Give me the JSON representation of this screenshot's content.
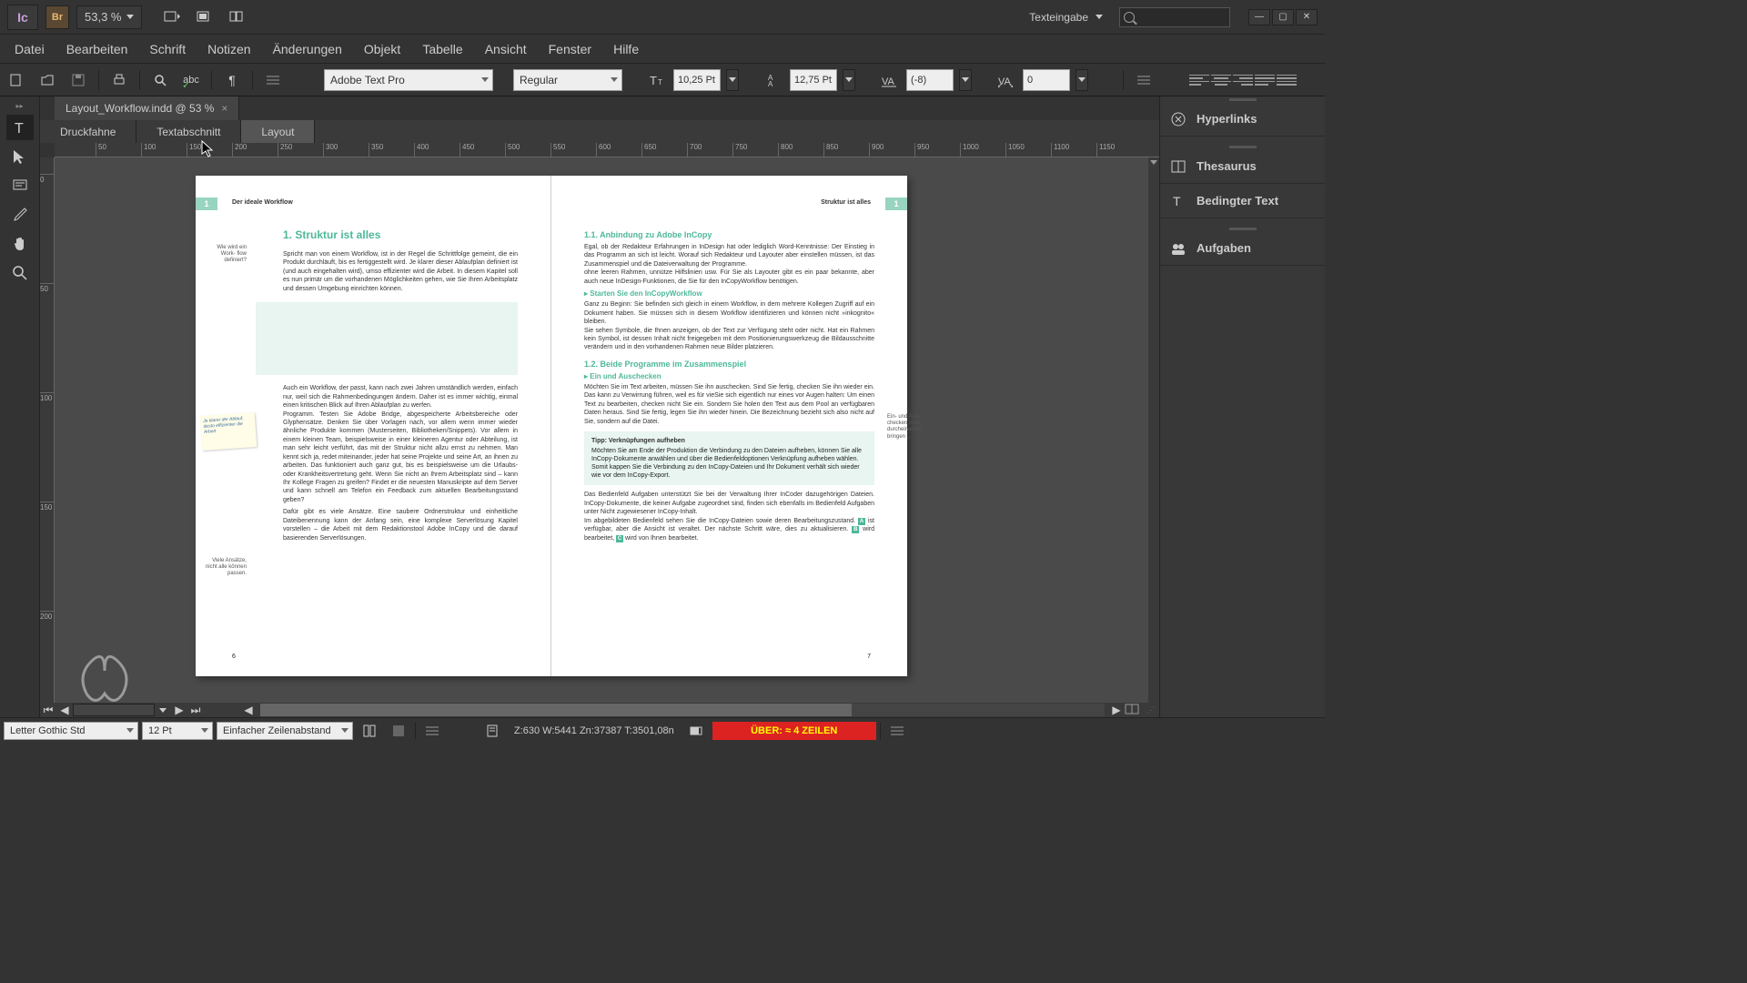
{
  "titlebar": {
    "ic_label": "Ic",
    "br_label": "Br",
    "zoom": "53,3 %",
    "workspace": "Texteingabe"
  },
  "menu": [
    "Datei",
    "Bearbeiten",
    "Schrift",
    "Notizen",
    "Änderungen",
    "Objekt",
    "Tabelle",
    "Ansicht",
    "Fenster",
    "Hilfe"
  ],
  "controlbar": {
    "font": "Adobe Text Pro",
    "font_style": "Regular",
    "font_size": "10,25 Pt",
    "leading": "12,75 Pt",
    "kerning": "(-8)",
    "tracking": "0"
  },
  "doc_tab": {
    "title": "Layout_Workflow.indd @ 53 %",
    "close": "×"
  },
  "view_tabs": [
    "Druckfahne",
    "Textabschnitt",
    "Layout"
  ],
  "ruler_h": [
    "50",
    "100",
    "150",
    "200",
    "250",
    "300",
    "350",
    "400",
    "450",
    "500",
    "550",
    "600",
    "650",
    "700",
    "750",
    "800",
    "850",
    "900",
    "950",
    "1000",
    "1050",
    "1100",
    "1150"
  ],
  "ruler_v": [
    "0",
    "50",
    "100",
    "150",
    "200"
  ],
  "panels": [
    "Hyperlinks",
    "Thesaurus",
    "Bedingter Text",
    "Aufgaben"
  ],
  "statusbar": {
    "font": "Letter Gothic Std",
    "size": "12 Pt",
    "leading_mode": "Einfacher Zeilenabstand",
    "stats": "Z:630    W:5441    Zn:37387   T:3501,08n",
    "overset": "ÜBER:   ≈ 4 ZEILEN"
  },
  "doc": {
    "left": {
      "badge": "1",
      "running": "Der ideale Workflow",
      "h1": "1.   Struktur ist alles",
      "side1": "Wie wird ein Work-\nflow definiert?",
      "p1": "Spricht man von einem Workflow, ist in der Regel die Schrittfolge gemeint, die ein Produkt durchläuft, bis es fertiggestellt wird. Je klarer dieser Ablaufplan definiert ist (und auch eingehalten wird), umso effizienter wird die Arbeit. In diesem Kapitel soll es nun primär um die vorhandenen Möglichkeiten gehen, wie Sie Ihren Arbeitsplatz und dessen Umgebung einrichten können.",
      "sticky": "Je klarer der Ablauf, desto effizienter die Arbeit",
      "p2": "Auch ein Workflow, der passt, kann nach zwei Jahren umständlich werden, einfach nur, weil sich die Rahmenbedingungen ändern. Daher ist es immer wichtig, einmal einen kritischen Blick auf Ihren Ablaufplan zu werfen.",
      "p2b": "Programm. Testen Sie Adobe Bridge, abgespeicherte Arbeitsbereiche oder Glyphensätze. Denken Sie über Vorlagen nach, vor allem wenn immer wieder ähnliche Produkte kommen (Musterseiten, Bibliotheken/Snippets). Vor allem in einem kleinen Team, beispielsweise in einer kleineren Agentur oder Abteilung, ist man sehr leicht verführt, das mit der Struktur nicht allzu ernst zu nehmen. Man kennt sich ja, redet miteinander, jeder hat seine Projekte und seine Art, an ihnen zu arbeiten. Das funktioniert auch ganz gut, bis es beispielsweise um die Urlaubs- oder Krankheitsvertretung geht. Wenn Sie nicht an Ihrem Arbeitsplatz sind – kann Ihr Kollege Fragen zu greifen? Findet er die neuesten Manuskripte auf dem Server und kann schnell am Telefon ein Feedback zum aktuellen Bearbeitungsstand geben?",
      "side3": "Viele Ansätze,\nnicht alle können\npassen.",
      "p3": "Dafür gibt es viele Ansätze. Eine saubere Ordnerstruktur und einheitliche Dateibenennung kann der Anfang sein, eine komplexe Serverlösung Kapitel vorstellen – die Arbeit mit dem Redaktionstool Adobe InCopy und die darauf basierenden Serverlösungen.",
      "pnum": "6"
    },
    "right": {
      "badge": "1",
      "running": "Struktur ist alles",
      "h2a": "1.1.   Anbindung zu Adobe InCopy",
      "p1": "Egal, ob der Redakteur Erfahrungen in InDesign hat oder lediglich Word-Kenntnisse: Der Einstieg in das Programm an sich ist leicht. Worauf sich Redakteur und Layouter aber einstellen müssen, ist das Zusammenspiel und die Dateiverwaltung der Programme.",
      "p1b": "ohne leeren Rahmen, unnütze Hilfslinien usw. Für Sie als Layouter gibt es ein paar bekannte, aber auch neue InDesign-Funktionen, die Sie für den InCopyWorkflow benötigen.",
      "h3a": "▸  Starten Sie den InCopyWorkflow",
      "p2": "Ganz zu Beginn: Sie befinden sich gleich in einem Workflow, in dem mehrere Kollegen Zugriff auf ein Dokument haben. Sie müssen sich in diesem Workflow identifizieren und können nicht »inkognito« bleiben.",
      "p2b": "Sie sehen Symbole, die Ihnen anzeigen, ob der Text zur Verfügung steht oder nicht. Hat ein Rahmen kein Symbol, ist dessen Inhalt nicht freigegeben mit dem Positionierungswerkzeug die Bildausschnitte verändern und in den vorhandenen Rahmen neue Bilder platzieren.",
      "h2b": "1.2.   Beide Programme im Zusammenspiel",
      "h3b": "▸  Ein und Auschecken",
      "side_r": "Ein- und Aus-\nchecken nicht\ndurcheinander\nbringen …",
      "p3": "Möchten Sie im Text arbeiten, müssen Sie ihn auschecken. Sind Sie fertig, checken Sie ihn wieder ein. Das kann zu Verwirrung führen, weil es für vieSie sich eigentlich nur eines vor Augen halten: Um einen Text zu bearbeiten, checken nicht Sie ein. Sondern Sie holen den Text aus dem Pool an verfügbaren Daten heraus. Sind Sie fertig, legen Sie ihn wieder hinein. Die Bezeichnung bezieht sich also nicht auf Sie, sondern auf die Datei.",
      "tip_title": "Tipp: Verknüpfungen aufheben",
      "tip_body": "Möchten Sie am Ende der Produktion die Verbindung zu den Dateien aufheben, können Sie alle InCopy-Dokumente anwählen und über die Bedienfeldoptionen Verknüpfung aufheben wählen. Somit kappen Sie die Verbindung zu den InCopy-Dateien und Ihr Dokument verhält sich wieder wie vor dem InCopy-Export.",
      "p4": "Das Bedienfeld Aufgaben unterstützt Sie bei der Verwaltung Ihrer InCoder dazugehörigen Dateien. InCopy-Dokumente, die keiner Aufgabe zugeordnet sind, finden sich ebenfalls im Bedienfeld Aufgaben unter Nicht zugewiesener InCopy-Inhalt.",
      "p4b_pre": "Im abgebildeten Bedienfeld sehen Sie die InCopy-Dateien sowie deren Bearbeitungszustand. ",
      "p4b_a": " ist verfügbar, aber die Ansicht ist veraltet. Der nächste Schritt wäre, dies zu aktualisieren. ",
      "p4b_b": " wird bearbeitet, ",
      "p4b_c": " wird von Ihnen bearbeitet.",
      "pnum": "7"
    }
  }
}
